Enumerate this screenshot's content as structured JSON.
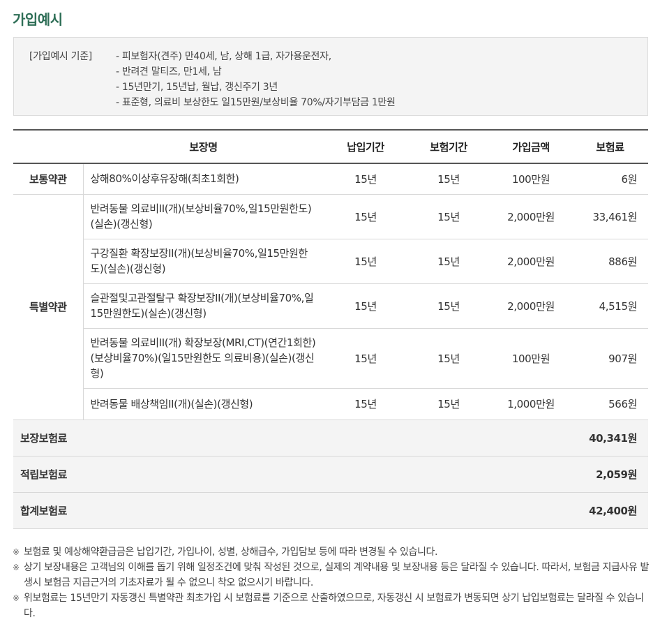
{
  "title": "가입예시",
  "criteria": {
    "label": "[가입예시 기준]",
    "lines": [
      "- 피보험자(견주) 만40세, 남, 상해 1급, 자가용운전자,",
      "- 반려견 말티즈, 만1세, 남",
      "- 15년만기, 15년납, 월납, 갱신주기 3년",
      "- 표준형, 의료비 보상한도 일15만원/보상비율 70%/자기부담금 1만원"
    ]
  },
  "table": {
    "headers": [
      "",
      "보장명",
      "납입기간",
      "보험기간",
      "가입금액",
      "보험료"
    ],
    "basic": {
      "category": "보통약관",
      "rows": [
        {
          "name": "상해80%이상후유장해(최초1회한)",
          "pay_period": "15년",
          "ins_period": "15년",
          "amount": "100만원",
          "premium": "6원"
        }
      ]
    },
    "special": {
      "category": "특별약관",
      "rows": [
        {
          "name": "반려동물 의료비II(개)(보상비율70%,일15만원한도)(실손)(갱신형)",
          "pay_period": "15년",
          "ins_period": "15년",
          "amount": "2,000만원",
          "premium": "33,461원"
        },
        {
          "name": "구강질환 확장보장II(개)(보상비율70%,일15만원한도)(실손)(갱신형)",
          "pay_period": "15년",
          "ins_period": "15년",
          "amount": "2,000만원",
          "premium": "886원"
        },
        {
          "name": "슬관절및고관절탈구 확장보장II(개)(보상비율70%,일15만원한도)(실손)(갱신형)",
          "pay_period": "15년",
          "ins_period": "15년",
          "amount": "2,000만원",
          "premium": "4,515원"
        },
        {
          "name": "반려동물 의료비II(개) 확장보장(MRI,CT)(연간1회한)(보상비율70%)(일15만원한도 의료비용)(실손)(갱신형)",
          "pay_period": "15년",
          "ins_period": "15년",
          "amount": "100만원",
          "premium": "907원"
        },
        {
          "name": "반려동물 배상책임II(개)(실손)(갱신형)",
          "pay_period": "15년",
          "ins_period": "15년",
          "amount": "1,000만원",
          "premium": "566원"
        }
      ]
    },
    "totals": [
      {
        "label": "보장보험료",
        "value": "40,341원"
      },
      {
        "label": "적립보험료",
        "value": "2,059원"
      },
      {
        "label": "합계보험료",
        "value": "42,400원"
      }
    ]
  },
  "notes": {
    "mark": "※",
    "items": [
      "보험료 및 예상해약환급금은 납입기간, 가입나이, 성별, 상해급수, 가입담보 등에 따라 변경될 수 있습니다.",
      "상기 보장내용은 고객님의 이해를 돕기 위해 일정조건에 맞춰 작성된 것으로, 실제의 계약내용 및 보장내용 등은 달라질 수 있습니다. 따라서, 보험금 지급사유 발생시 보험금 지급근거의 기초자료가 될 수 없으니 착오 없으시기 바랍니다.",
      "위보험료는 15년만기 자동갱신 특별약관 최초가입 시 보험료를 기준으로 산출하였으므로, 자동갱신 시 보험료가 변동되면 상기 납입보험료는 달라질 수 있습니다."
    ]
  },
  "colors": {
    "title": "#2e6e56",
    "total_value": "#c0451d",
    "box_bg": "#f4f4f4"
  }
}
